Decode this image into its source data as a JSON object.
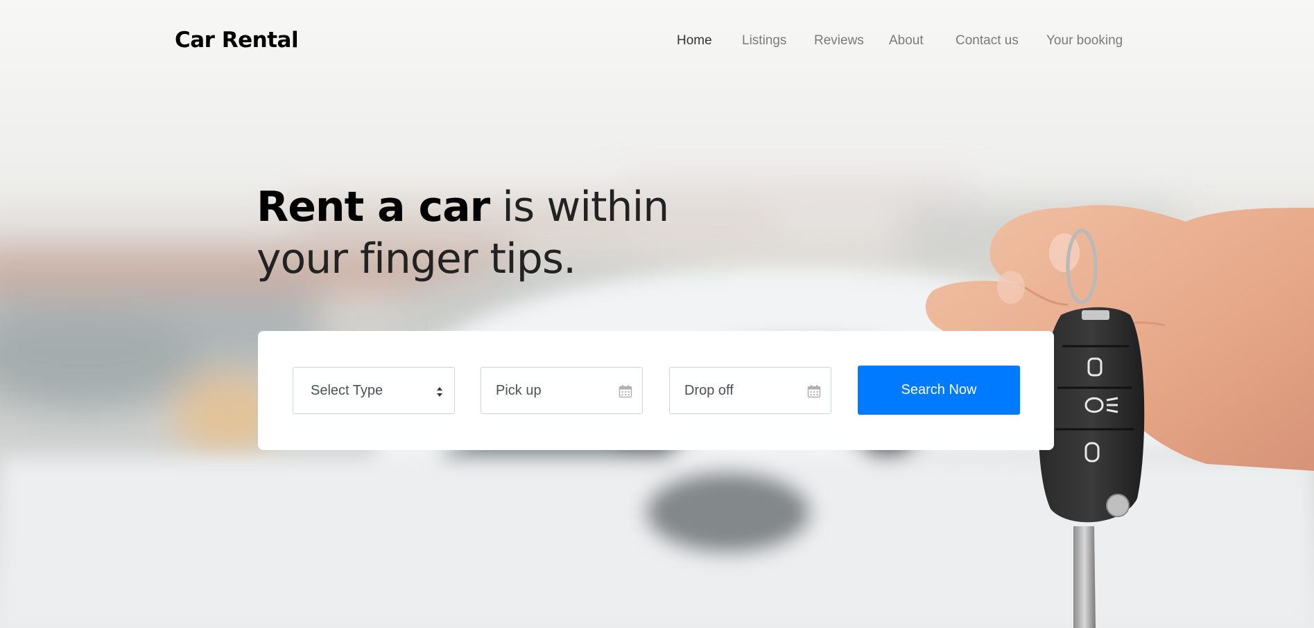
{
  "brand": {
    "name": "Car Rental"
  },
  "nav": {
    "items": [
      {
        "label": "Home",
        "active": true
      },
      {
        "label": "Listings",
        "active": false
      },
      {
        "label": "Reviews",
        "active": false
      },
      {
        "label": "About",
        "active": false
      },
      {
        "label": "Contact us",
        "active": false
      },
      {
        "label": "Your booking",
        "active": false
      }
    ]
  },
  "hero": {
    "title_strong": "Rent a car",
    "title_rest": " is within",
    "title_line2": "your finger tips."
  },
  "search": {
    "type_select": {
      "value": "Select Type",
      "icon": "select-arrows-icon"
    },
    "pickup": {
      "placeholder": "Pick up",
      "icon": "calendar-icon"
    },
    "dropoff": {
      "placeholder": "Drop off",
      "icon": "calendar-icon"
    },
    "button_label": "Search Now"
  },
  "colors": {
    "primary": "#007bff",
    "nav_text": "#7a7a7a",
    "nav_active": "#333333",
    "card_bg": "#ffffff"
  }
}
